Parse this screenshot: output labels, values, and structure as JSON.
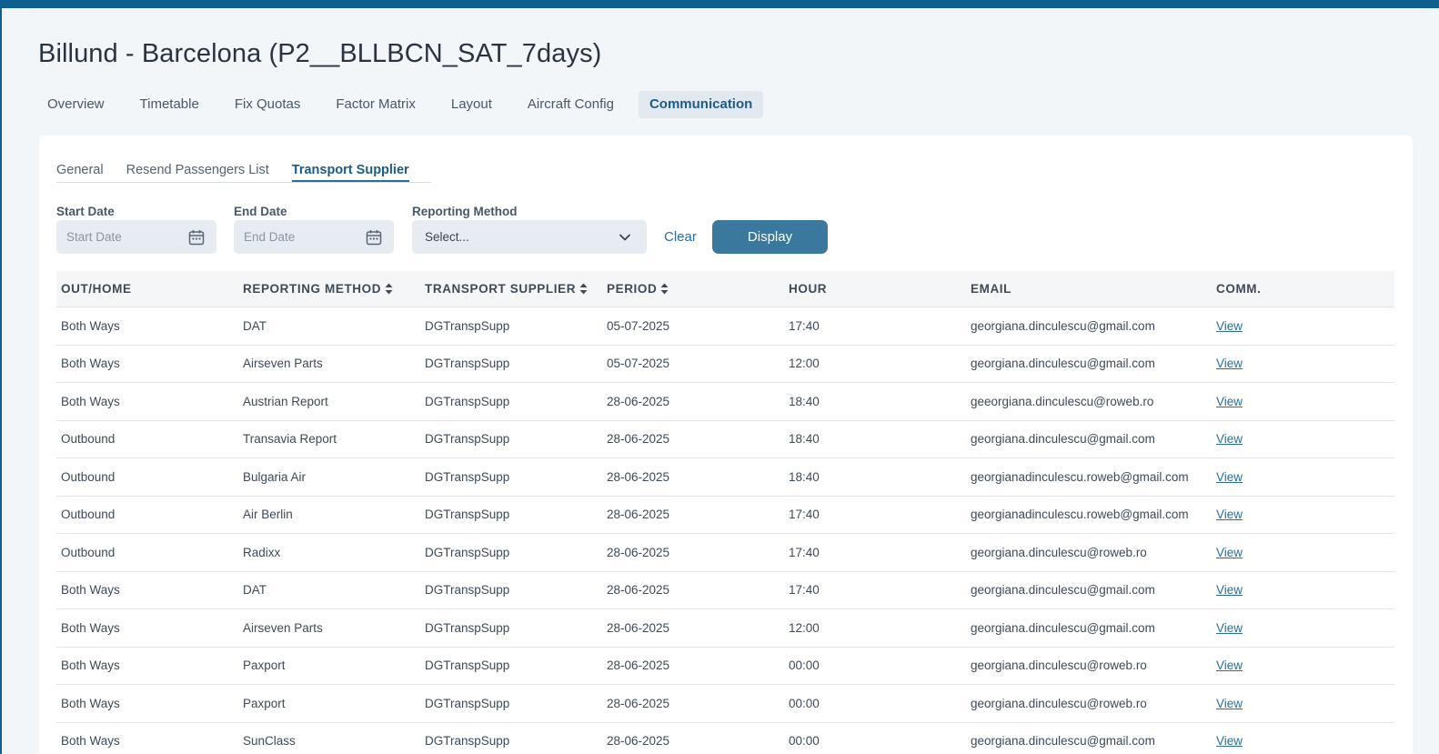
{
  "page": {
    "title": "Billund - Barcelona (P2__BLLBCN_SAT_7days)"
  },
  "main_tabs": [
    {
      "label": "Overview",
      "active": false
    },
    {
      "label": "Timetable",
      "active": false
    },
    {
      "label": "Fix Quotas",
      "active": false
    },
    {
      "label": "Factor Matrix",
      "active": false
    },
    {
      "label": "Layout",
      "active": false
    },
    {
      "label": "Aircraft Config",
      "active": false
    },
    {
      "label": "Communication",
      "active": true
    }
  ],
  "sub_tabs": [
    {
      "label": "General",
      "active": false
    },
    {
      "label": "Resend Passengers List",
      "active": false
    },
    {
      "label": "Transport Supplier",
      "active": true
    }
  ],
  "filters": {
    "start_date": {
      "label": "Start Date",
      "placeholder": "Start Date",
      "icon": "calendar-icon"
    },
    "end_date": {
      "label": "End Date",
      "placeholder": "End Date",
      "icon": "calendar-icon"
    },
    "reporting_method": {
      "label": "Reporting Method",
      "placeholder": "Select...",
      "icon": "chevron-down-icon"
    },
    "clear_label": "Clear",
    "display_label": "Display"
  },
  "table": {
    "headers": [
      "OUT/HOME",
      "REPORTING METHOD",
      "TRANSPORT SUPPLIER",
      "PERIOD",
      "HOUR",
      "EMAIL",
      "COMM."
    ],
    "sortable": [
      false,
      true,
      true,
      true,
      false,
      false,
      false
    ],
    "rows": [
      [
        "Both Ways",
        "DAT",
        "DGTranspSupp",
        "05-07-2025",
        "17:40",
        "georgiana.dinculescu@gmail.com",
        "View"
      ],
      [
        "Both Ways",
        "Airseven Parts",
        "DGTranspSupp",
        "05-07-2025",
        "12:00",
        "georgiana.dinculescu@gmail.com",
        "View"
      ],
      [
        "Both Ways",
        "Austrian Report",
        "DGTranspSupp",
        "28-06-2025",
        "18:40",
        "geeorgiana.dinculescu@roweb.ro",
        "View"
      ],
      [
        "Outbound",
        "Transavia Report",
        "DGTranspSupp",
        "28-06-2025",
        "18:40",
        "georgiana.dinculescu@gmail.com",
        "View"
      ],
      [
        "Outbound",
        "Bulgaria Air",
        "DGTranspSupp",
        "28-06-2025",
        "18:40",
        "georgianadinculescu.roweb@gmail.com",
        "View"
      ],
      [
        "Outbound",
        "Air Berlin",
        "DGTranspSupp",
        "28-06-2025",
        "17:40",
        "georgianadinculescu.roweb@gmail.com",
        "View"
      ],
      [
        "Outbound",
        "Radixx",
        "DGTranspSupp",
        "28-06-2025",
        "17:40",
        "georgiana.dinculescu@roweb.ro",
        "View"
      ],
      [
        "Both Ways",
        "DAT",
        "DGTranspSupp",
        "28-06-2025",
        "17:40",
        "georgiana.dinculescu@gmail.com",
        "View"
      ],
      [
        "Both Ways",
        "Airseven Parts",
        "DGTranspSupp",
        "28-06-2025",
        "12:00",
        "georgiana.dinculescu@gmail.com",
        "View"
      ],
      [
        "Both Ways",
        "Paxport",
        "DGTranspSupp",
        "28-06-2025",
        "00:00",
        "georgiana.dinculescu@roweb.ro",
        "View"
      ],
      [
        "Both Ways",
        "Paxport",
        "DGTranspSupp",
        "28-06-2025",
        "00:00",
        "georgiana.dinculescu@roweb.ro",
        "View"
      ],
      [
        "Both Ways",
        "SunClass",
        "DGTranspSupp",
        "28-06-2025",
        "00:00",
        "georgiana.dinculescu@gmail.com",
        "View"
      ]
    ]
  },
  "colors": {
    "brand": "#0e6091",
    "accent": "#2a6f99",
    "button": "#3a789e",
    "active_tab_bg": "#e1e8ef"
  }
}
